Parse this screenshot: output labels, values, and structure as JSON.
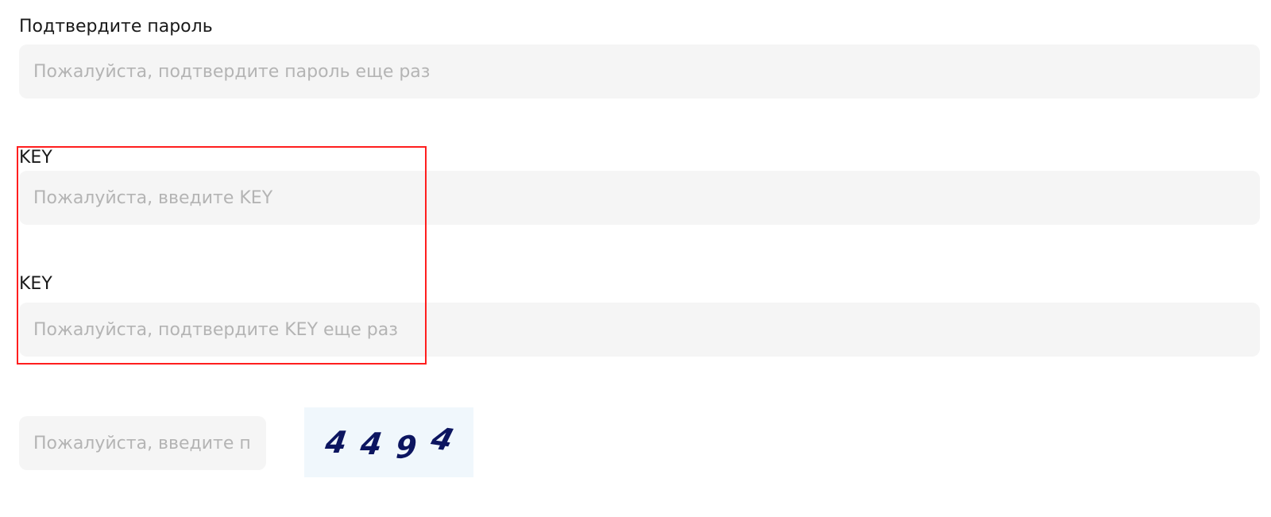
{
  "confirm_password": {
    "label": "Подтвердите пароль",
    "placeholder": "Пожалуйста, подтвердите пароль еще раз",
    "value": ""
  },
  "key": {
    "label": "KEY",
    "placeholder": "Пожалуйста, введите KEY",
    "value": ""
  },
  "confirm_key": {
    "label": "KEY",
    "placeholder": "Пожалуйста, подтвердите KEY еще раз",
    "value": ""
  },
  "captcha": {
    "placeholder": "Пожалуйста, введите проверочный код",
    "value": "",
    "image_chars": [
      "4",
      "4",
      "9",
      "4"
    ]
  },
  "colors": {
    "highlight": "#ff1e1e",
    "captcha_text": "#0c1560",
    "field_bg": "#f5f5f5"
  }
}
